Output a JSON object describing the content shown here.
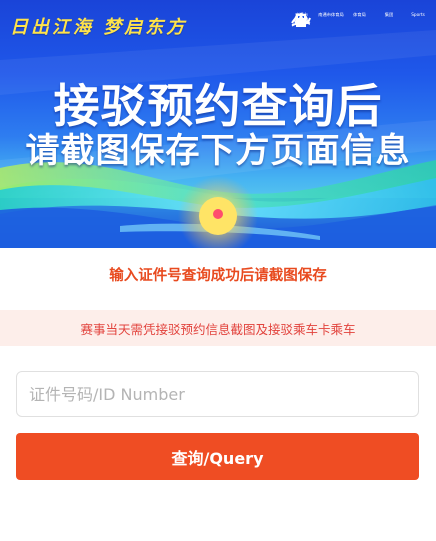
{
  "banner": {
    "slogan": "日出江海  梦启东方",
    "headline_line1": "接驳预约查询后",
    "headline_line2": "请截图保存下方页面信息",
    "sponsors": [
      {
        "icon": "city-emblem-icon",
        "caption": "南通市"
      },
      {
        "icon": "sports-bureau-icon",
        "caption": "南通市体育局"
      },
      {
        "icon": "sun-wave-icon",
        "caption": "体育局"
      },
      {
        "icon": "building-group-icon",
        "caption": "集团"
      },
      {
        "icon": "star-sports-icon",
        "caption": "Sports"
      }
    ]
  },
  "main": {
    "instruction": "输入证件号查询成功后请截图保存",
    "notice": "赛事当天需凭接驳预约信息截图及接驳乘车卡乘车",
    "id_input": {
      "placeholder": "证件号码/ID Number",
      "value": ""
    },
    "query_button_label": "查询/Query"
  },
  "colors": {
    "accent": "#ef4d23",
    "instruction_text": "#e84a1f",
    "notice_bg": "#fdeeea",
    "notice_text": "#e2433d",
    "slogan": "#ffe34a",
    "banner_blue": "#1f58ea"
  }
}
